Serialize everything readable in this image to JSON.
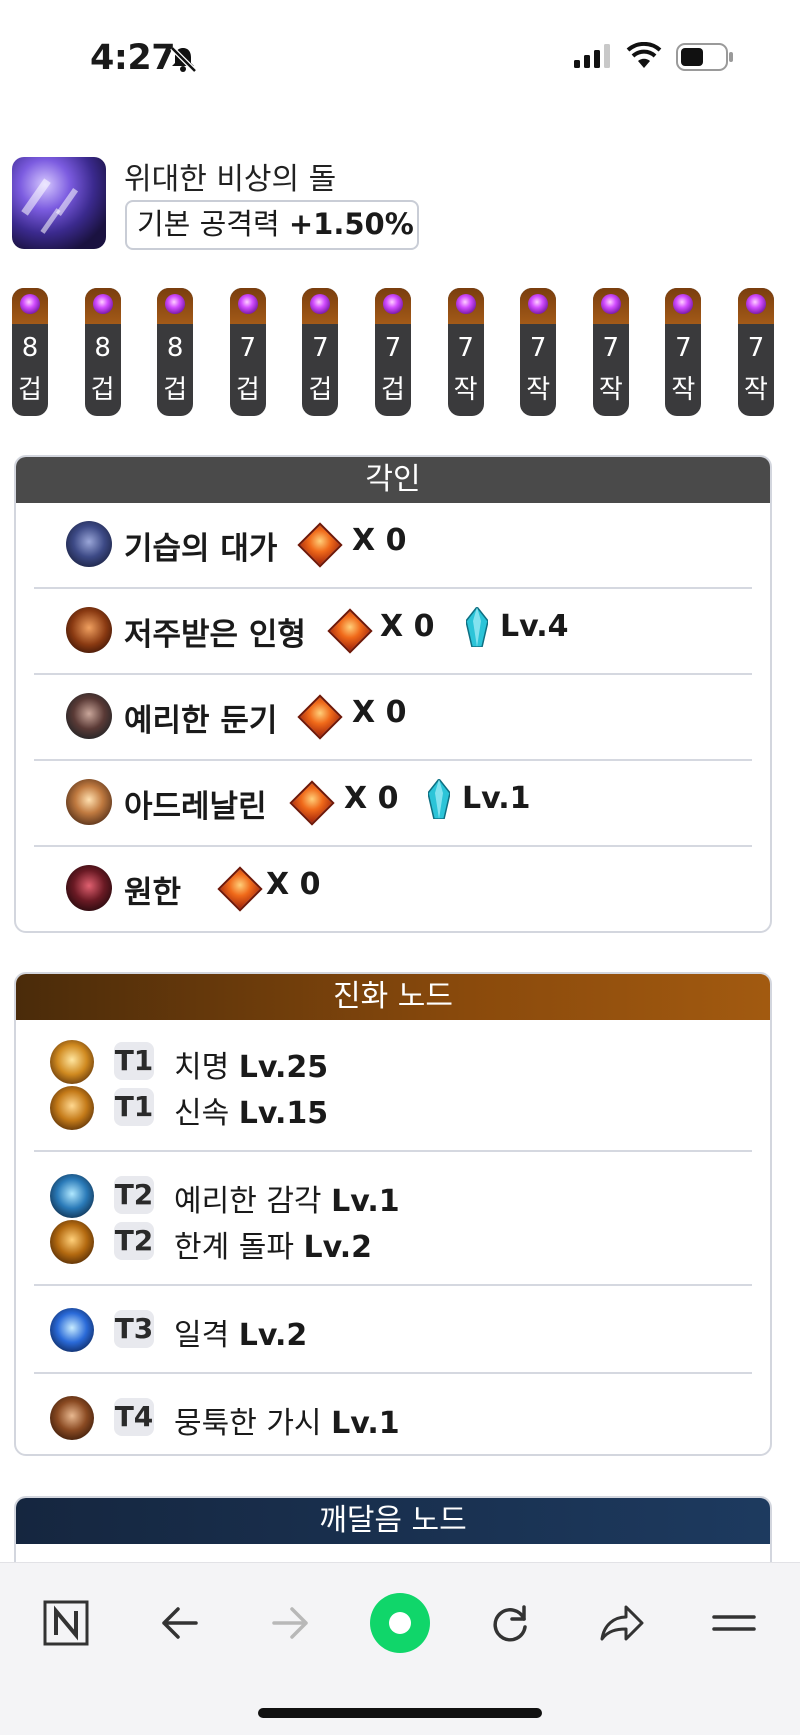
{
  "status": {
    "time": "4:27"
  },
  "item": {
    "name": "위대한 비상의 돌",
    "stat_label": "기본 공격력",
    "stat_value": "+1.50%"
  },
  "stacks": [
    {
      "count": "8",
      "unit": "겁"
    },
    {
      "count": "8",
      "unit": "겁"
    },
    {
      "count": "8",
      "unit": "겁"
    },
    {
      "count": "7",
      "unit": "겁"
    },
    {
      "count": "7",
      "unit": "겁"
    },
    {
      "count": "7",
      "unit": "겁"
    },
    {
      "count": "7",
      "unit": "작"
    },
    {
      "count": "7",
      "unit": "작"
    },
    {
      "count": "7",
      "unit": "작"
    },
    {
      "count": "7",
      "unit": "작"
    },
    {
      "count": "7",
      "unit": "작"
    }
  ],
  "engravings": {
    "title": "각인",
    "items": [
      {
        "name": "기습의 대가",
        "count": "X 0",
        "level": ""
      },
      {
        "name": "저주받은 인형",
        "count": "X 0",
        "level": "Lv.4"
      },
      {
        "name": "예리한 둔기",
        "count": "X 0",
        "level": ""
      },
      {
        "name": "아드레날린",
        "count": "X 0",
        "level": "Lv.1"
      },
      {
        "name": "원한",
        "count": "X 0",
        "level": ""
      }
    ]
  },
  "evolution": {
    "title": "진화 노드",
    "groups": [
      {
        "lines": [
          {
            "tier": "T1",
            "name": "치명",
            "level": "Lv.25"
          },
          {
            "tier": "T1",
            "name": "신속",
            "level": "Lv.15"
          }
        ]
      },
      {
        "lines": [
          {
            "tier": "T2",
            "name": "예리한 감각",
            "level": "Lv.1"
          },
          {
            "tier": "T2",
            "name": "한계 돌파",
            "level": "Lv.2"
          }
        ]
      },
      {
        "lines": [
          {
            "tier": "T3",
            "name": "일격",
            "level": "Lv.2"
          }
        ]
      },
      {
        "lines": [
          {
            "tier": "T4",
            "name": "뭉툭한 가시",
            "level": "Lv.1"
          }
        ]
      }
    ]
  },
  "enlightenment": {
    "title": "깨달음 노드"
  },
  "nav": {
    "items": [
      "naver-home-icon",
      "back-arrow-icon",
      "forward-arrow-icon",
      "green-dot-icon",
      "reload-icon",
      "share-icon",
      "menu-icon"
    ]
  }
}
